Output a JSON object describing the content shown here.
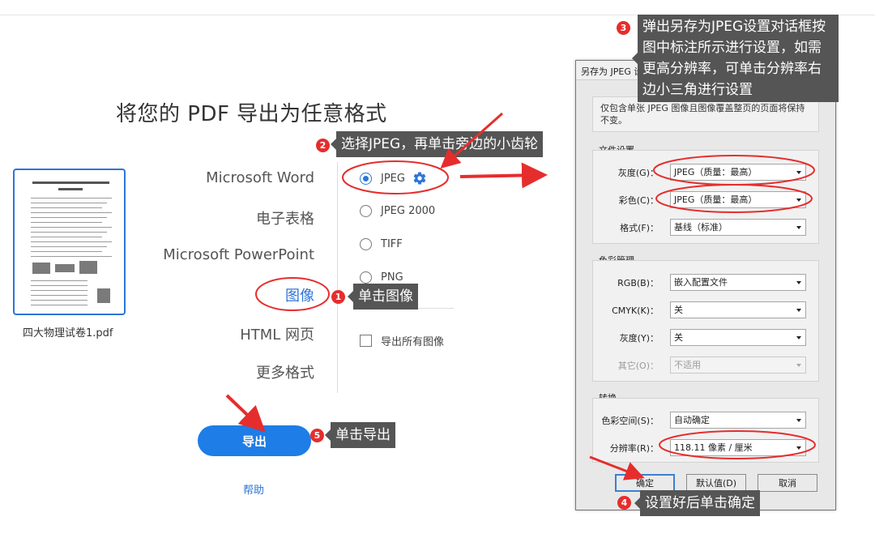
{
  "page": {
    "title": "将您的 PDF 导出为任意格式"
  },
  "file": {
    "name": "四大物理试卷1.pdf"
  },
  "formats": [
    "Microsoft Word",
    "电子表格",
    "Microsoft PowerPoint",
    "图像",
    "HTML 网页",
    "更多格式"
  ],
  "selected_format": "图像",
  "image_options": {
    "radios": [
      {
        "label": "JPEG",
        "selected": true
      },
      {
        "label": "JPEG 2000",
        "selected": false
      },
      {
        "label": "TIFF",
        "selected": false
      },
      {
        "label": "PNG",
        "selected": false
      }
    ],
    "export_all_label": "导出所有图像",
    "export_all_checked": false
  },
  "buttons": {
    "export": "导出",
    "help": "帮助"
  },
  "dialog": {
    "title": "另存为 JPEG 设",
    "info": "仅包含单张 JPEG 图像且图像覆盖整页的页面将保持不变。",
    "file_settings": {
      "title": "文件设置",
      "gray_label": "灰度(G)：",
      "gray_value": "JPEG（质量：最高）",
      "color_label": "彩色(C)：",
      "color_value": "JPEG（质量：最高）",
      "format_label": "格式(F)：",
      "format_value": "基线（标准）"
    },
    "color_management": {
      "title": "色彩管理",
      "rgb_label": "RGB(B)：",
      "rgb_value": "嵌入配置文件",
      "cmyk_label": "CMYK(K)：",
      "cmyk_value": "关",
      "gray_label": "灰度(Y)：",
      "gray_value": "关",
      "other_label": "其它(O)：",
      "other_value": "不适用"
    },
    "conversion": {
      "title": "转换",
      "colorspace_label": "色彩空间(S)：",
      "colorspace_value": "自动确定",
      "resolution_label": "分辨率(R)：",
      "resolution_value": "118.11 像素 / 厘米"
    },
    "buttons": {
      "ok": "确定",
      "default": "默认值(D)",
      "cancel": "取消"
    }
  },
  "annotations": [
    {
      "num": "1",
      "text": "单击图像"
    },
    {
      "num": "2",
      "text": "选择JPEG，再单击旁边的小齿轮"
    },
    {
      "num": "3",
      "text": "弹出另存为JPEG设置对话框按图中标注所示进行设置，如需更高分辨率，可单击分辨率右边小三角进行设置"
    },
    {
      "num": "4",
      "text": "设置好后单击确定"
    },
    {
      "num": "5",
      "text": "单击导出"
    }
  ],
  "colors": {
    "accent": "#1e7de6",
    "annotation": "#e62d2d",
    "callout_bg": "#555555"
  }
}
